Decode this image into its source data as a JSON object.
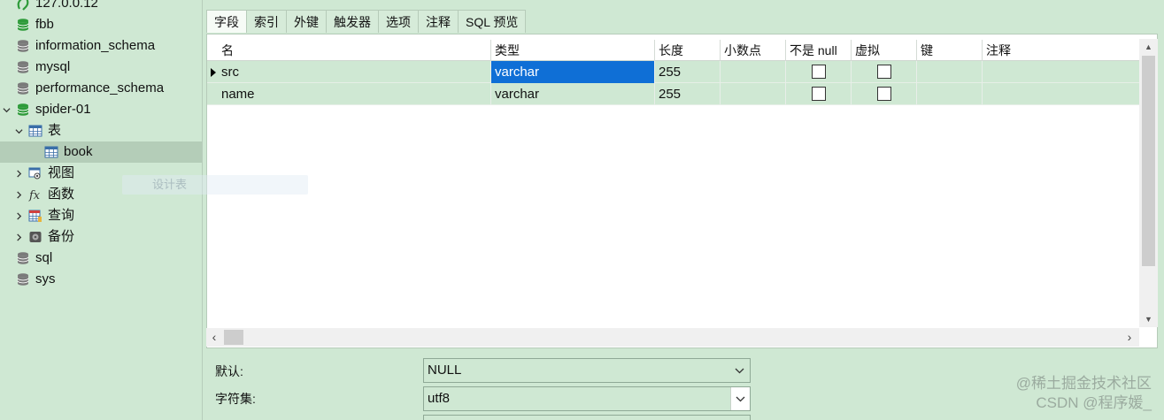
{
  "sidebar": {
    "items": [
      {
        "label": "127.0.0.12",
        "icon": "connection-icon",
        "level": 0,
        "expander": "none"
      },
      {
        "label": "fbb",
        "icon": "database-open-icon",
        "level": 0,
        "expander": "none"
      },
      {
        "label": "information_schema",
        "icon": "database-icon",
        "level": 0,
        "expander": "none"
      },
      {
        "label": "mysql",
        "icon": "database-icon",
        "level": 0,
        "expander": "none"
      },
      {
        "label": "performance_schema",
        "icon": "database-icon",
        "level": 0,
        "expander": "none"
      },
      {
        "label": "spider-01",
        "icon": "database-open-icon",
        "level": 0,
        "expander": "expanded"
      },
      {
        "label": "表",
        "icon": "table-icon",
        "level": 1,
        "expander": "expanded"
      },
      {
        "label": "book",
        "icon": "table-icon",
        "level": 2,
        "expander": "none",
        "selected": true
      },
      {
        "label": "视图",
        "icon": "view-icon",
        "level": 1,
        "expander": "collapsed"
      },
      {
        "label": "函数",
        "icon": "function-icon",
        "level": 1,
        "expander": "collapsed"
      },
      {
        "label": "查询",
        "icon": "query-icon",
        "level": 1,
        "expander": "collapsed"
      },
      {
        "label": "备份",
        "icon": "backup-icon",
        "level": 1,
        "expander": "collapsed"
      },
      {
        "label": "sql",
        "icon": "database-icon",
        "level": 0,
        "expander": "none"
      },
      {
        "label": "sys",
        "icon": "database-icon",
        "level": 0,
        "expander": "none"
      }
    ]
  },
  "ghost_tooltip": "设计表",
  "tabs": [
    "字段",
    "索引",
    "外键",
    "触发器",
    "选项",
    "注释",
    "SQL 预览"
  ],
  "active_tab": "字段",
  "grid": {
    "columns": [
      "名",
      "类型",
      "长度",
      "小数点",
      "不是 null",
      "虚拟",
      "键",
      "注释"
    ],
    "rows": [
      {
        "name": "src",
        "type": "varchar",
        "length": "255",
        "decimals": "",
        "not_null": false,
        "virtual": false,
        "key": "",
        "comment": "",
        "current": true
      },
      {
        "name": "name",
        "type": "varchar",
        "length": "255",
        "decimals": "",
        "not_null": false,
        "virtual": false,
        "key": "",
        "comment": "",
        "current": false
      }
    ]
  },
  "props": {
    "default_label": "默认:",
    "default_value": "NULL",
    "charset_label": "字符集:",
    "charset_value": "utf8"
  },
  "watermark": {
    "line1": "@稀土掘金技术社区",
    "line2": "CSDN @程序媛_"
  },
  "colors": {
    "background": "#cfe8d3",
    "selection": "#0f6fd6",
    "db_green": "#2e9b3a",
    "db_gray": "#7a7a7a"
  }
}
